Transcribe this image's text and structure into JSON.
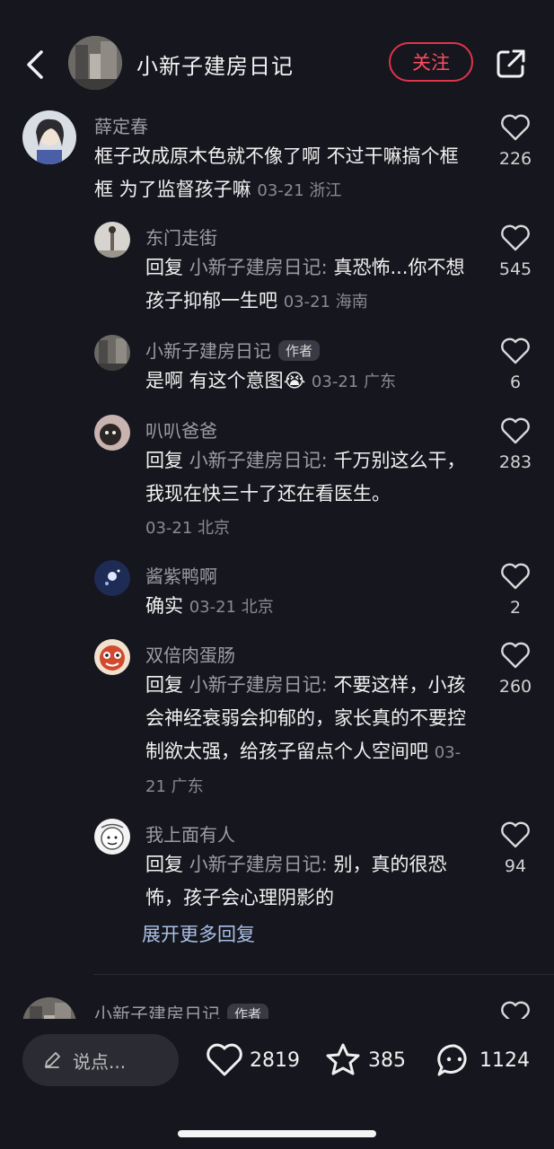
{
  "header": {
    "title": "小新子建房日记",
    "follow_label": "关注",
    "back_icon": "chevron-left-icon",
    "share_icon": "share-out-icon"
  },
  "comments": {
    "main": {
      "user": "薛定春",
      "text": "框子改成原木色就不像了啊 不过干嘛搞个框框 为了监督孩子嘛",
      "meta": "03-21 浙江",
      "likes": "226"
    },
    "replies": [
      {
        "user": "东门走街",
        "reply_prefix": "回复",
        "reply_target": "小新子建房日记:",
        "text": "真恐怖...你不想孩子抑郁一生吧",
        "meta": "03-21 海南",
        "likes": "545"
      },
      {
        "user": "小新子建房日记",
        "author_tag": "作者",
        "text": "是啊 有这个意图",
        "emoji": "😭",
        "meta": "03-21 广东",
        "likes": "6"
      },
      {
        "user": "叭叭爸爸",
        "reply_prefix": "回复",
        "reply_target": "小新子建房日记:",
        "text": "千万别这么干，我现在快三十了还在看医生。",
        "meta": "03-21 北京",
        "likes": "283"
      },
      {
        "user": "酱紫鸭啊",
        "text": "确实",
        "meta": "03-21 北京",
        "likes": "2"
      },
      {
        "user": "双倍肉蛋肠",
        "reply_prefix": "回复",
        "reply_target": "小新子建房日记:",
        "text": "不要这样，小孩会神经衰弱会抑郁的，家长真的不要控制欲太强，给孩子留点个人空间吧",
        "meta": "03-21 广东",
        "likes": "260"
      },
      {
        "user": "我上面有人",
        "reply_prefix": "回复",
        "reply_target": "小新子建房日记:",
        "text": "别，真的很恐怖，孩子会心理阴影的",
        "likes": "94"
      }
    ],
    "expand_label": "展开更多回复",
    "next": {
      "user": "小新子建房日记",
      "author_tag": "作者"
    }
  },
  "bottom": {
    "input_placeholder": "说点...",
    "likes": "2819",
    "stars": "385",
    "comments": "1124"
  },
  "colors": {
    "accent": "#ff4d5e",
    "link": "#a9c0e6",
    "background": "#16161e"
  }
}
